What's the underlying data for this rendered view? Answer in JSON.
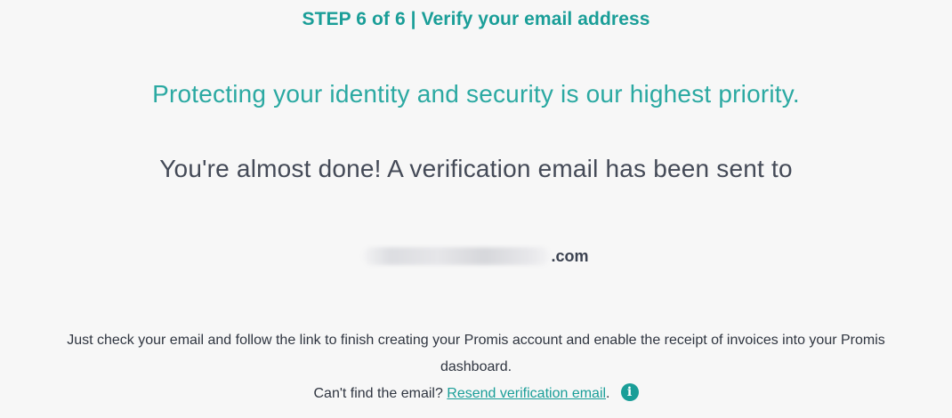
{
  "header": {
    "step_title": "STEP 6 of 6 | Verify your email address"
  },
  "main": {
    "priority_message": "Protecting your identity and security is our highest priority.",
    "almost_done_message": "You're almost done! A verification email has been sent to",
    "email_suffix": ".com",
    "instructions_line1": "Just check your email and follow the link to finish creating your Promis account and enable the receipt of invoices into your Promis",
    "instructions_line2": "dashboard.",
    "cant_find_prefix": "Can't find the email? ",
    "resend_link_label": "Resend verification email",
    "resend_suffix": ".",
    "info_icon_glyph": "i"
  },
  "icons": {
    "info": "info-icon"
  },
  "colors": {
    "accent": "#1a9e98",
    "heading_teal": "#2ba9a2",
    "body_text": "#3b4250",
    "background": "#f7f7f7"
  }
}
